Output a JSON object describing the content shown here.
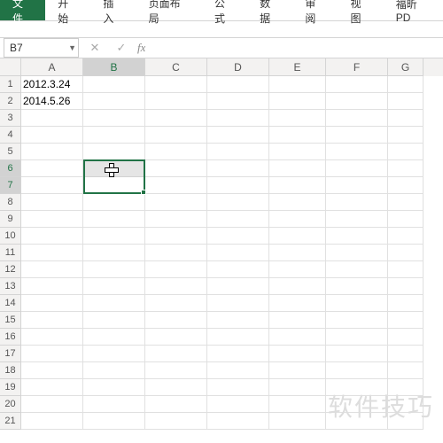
{
  "ribbon": {
    "tabs": [
      "文件",
      "开始",
      "插入",
      "页面布局",
      "公式",
      "数据",
      "审阅",
      "视图",
      "福昕PD"
    ]
  },
  "namebox": {
    "value": "B7"
  },
  "fx": {
    "cancel": "✕",
    "accept": "✓",
    "label": "fx"
  },
  "columns": [
    "A",
    "B",
    "C",
    "D",
    "E",
    "F",
    "G"
  ],
  "rows": {
    "count": 21
  },
  "cells": {
    "A1": "2012.3.24",
    "A2": "2014.5.26"
  },
  "selection": {
    "range": "B6:B7",
    "active": "B7"
  },
  "watermark": "软件技巧"
}
